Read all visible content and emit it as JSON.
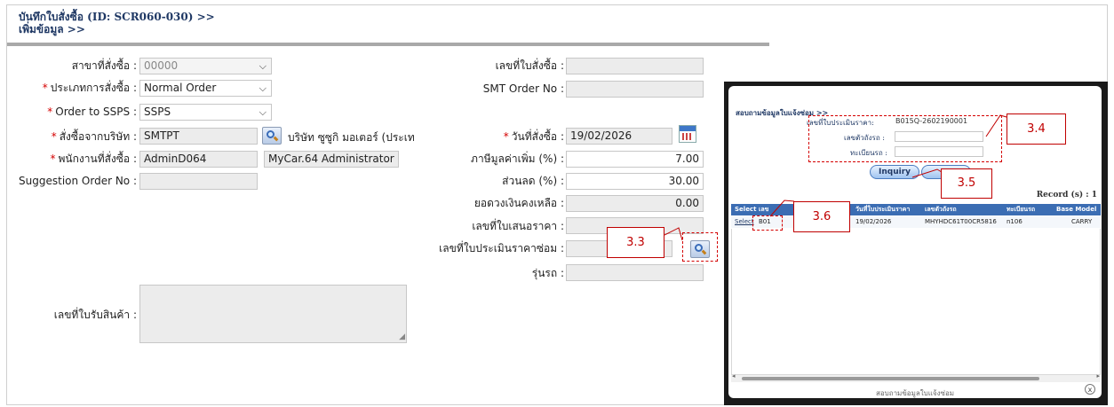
{
  "page": {
    "title_line1": "บันทึกใบสั่งซื้อ (ID: SCR060-030) >>",
    "title_line2": "เพิ่มข้อมูล >>"
  },
  "form": {
    "branch_label": "สาขาที่สั่งซื้อ :",
    "branch_value": "00000",
    "order_type_label": "ประเภทการสั่งซื้อ :",
    "order_type_value": "Normal Order",
    "order_to_label": "Order to SSPS :",
    "order_to_value": "SSPS",
    "company_label": "สั่งซื้อจากบริษัท :",
    "company_code": "SMTPT",
    "company_name": "บริษัท ซูซูกิ มอเตอร์ (ประเท",
    "employee_label": "พนักงานที่สั่งซื้อ :",
    "employee_code": "AdminD064",
    "employee_name": "MyCar.64 Administrator",
    "suggestion_label": "Suggestion Order No :",
    "suggestion_value": "",
    "receipt_label": "เลขที่ใบรับสินค้า :",
    "po_no_label": "เลขที่ใบสั่งซื้อ :",
    "po_no_value": "",
    "smt_label": "SMT Order No :",
    "smt_value": "",
    "order_date_label": "วันที่สั่งซื้อ :",
    "order_date_value": "19/02/2026",
    "vat_label": "ภาษีมูลค่าเพิ่ม (%) :",
    "vat_value": "7.00",
    "discount_label": "ส่วนลด (%) :",
    "discount_value": "30.00",
    "balance_label": "ยอดวงเงินคงเหลือ :",
    "balance_value": "0.00",
    "quote_label": "เลขที่ใบเสนอราคา :",
    "quote_value": "",
    "repair_est_label": "เลขที่ใบประเมินราคาซ่อม :",
    "repair_est_value": "",
    "model_label": "รุ่นรถ :",
    "model_value": ""
  },
  "modal": {
    "title": "สอบถามข้อมูลใบแจ้งซ่อม >>",
    "est_no_label": "เลขที่ใบประเมินราคา:",
    "est_no_value": "B015Q-2602190001",
    "chassis_label": "เลขตัวถังรถ :",
    "plate_label": "ทะเบียนรถ :",
    "inquiry_button": "Inquiry",
    "record_text": "Record (s) : 1",
    "columns": [
      "Select",
      "เลข",
      "วันที่ใบประเมินราคา",
      "เลขตัวถังรถ",
      "ทะเบียนรถ",
      "Base Model"
    ],
    "row": {
      "select": "Select",
      "est_no": "B01",
      "date": "19/02/2026",
      "chassis": "MHYHDC61T00CR5816",
      "plate": "n106",
      "model": "CARRY"
    },
    "footer": "สอบถามข้อมูลใบแจ้งซ่อม",
    "close": "x"
  },
  "callouts": {
    "c33": "3.3",
    "c34": "3.4",
    "c35": "3.5",
    "c36": "3.6"
  }
}
